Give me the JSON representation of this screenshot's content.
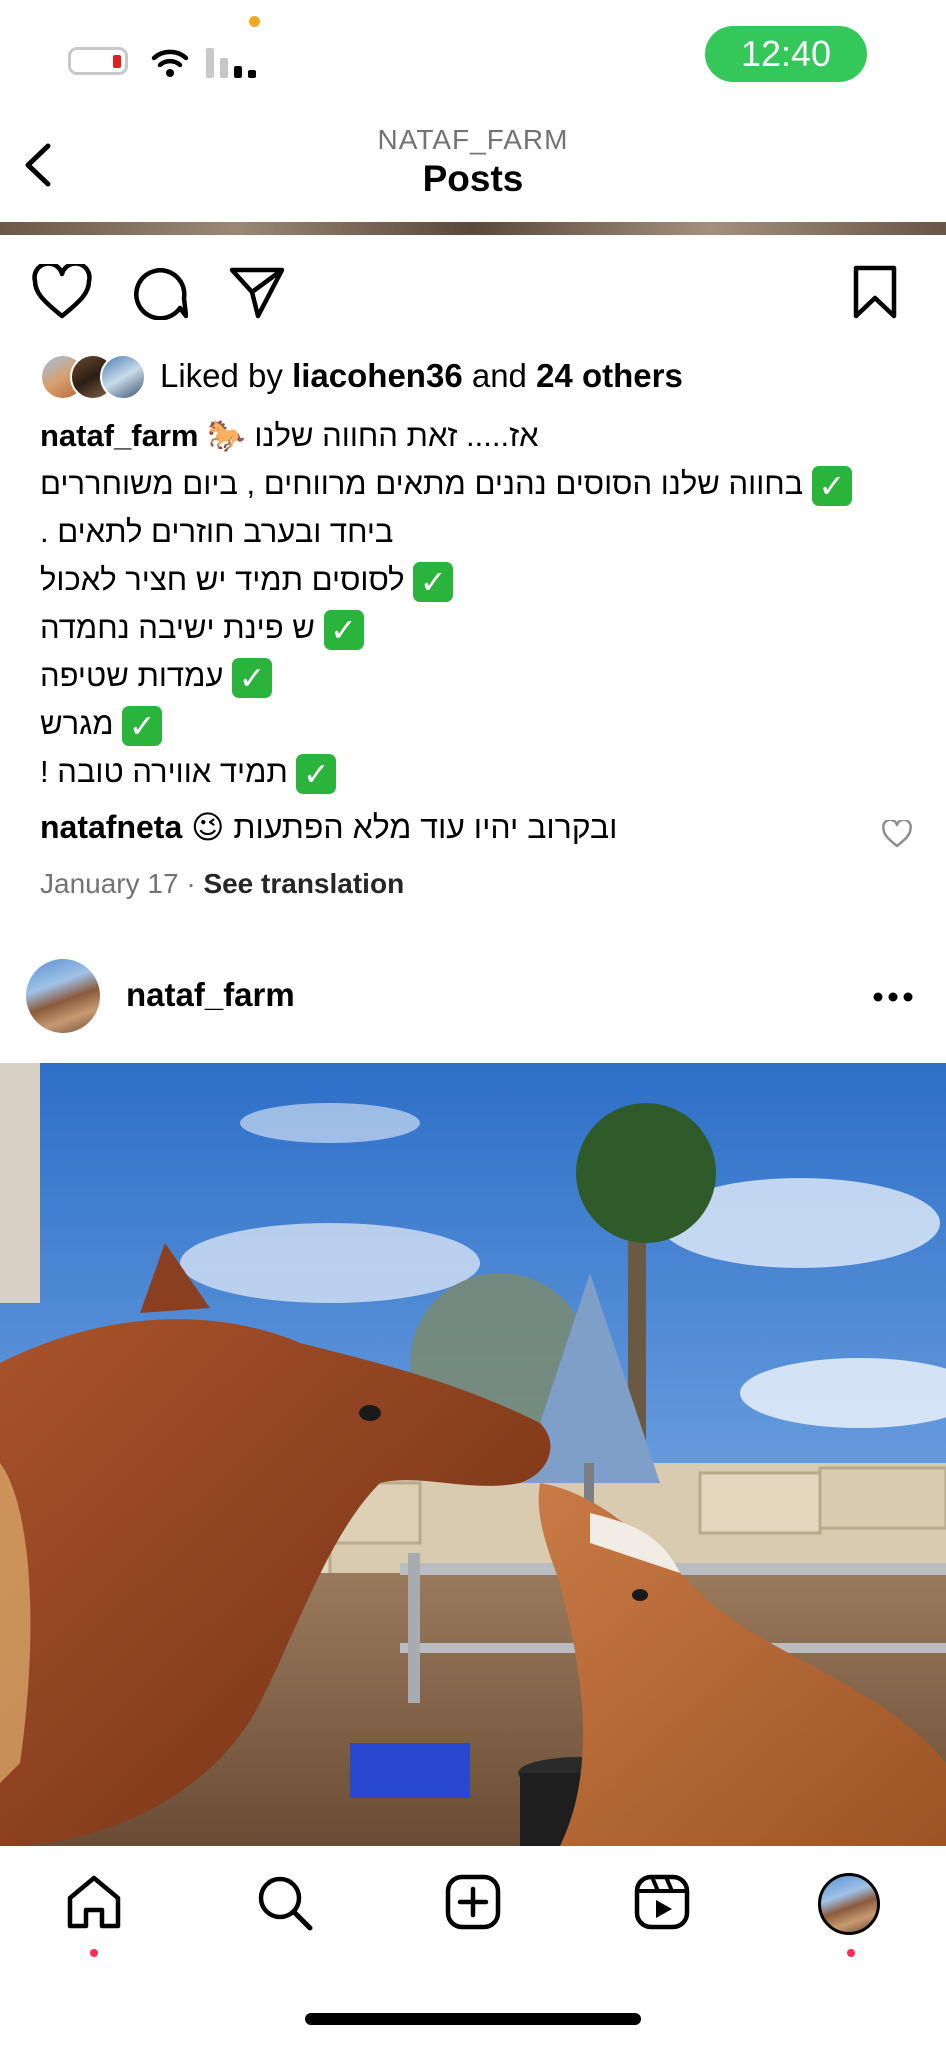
{
  "status_bar": {
    "time": "12:40",
    "battery_level": 0.1
  },
  "nav": {
    "account": "NATAF_FARM",
    "title": "Posts"
  },
  "post1": {
    "liked_by_prefix": "Liked by ",
    "liked_by_user": "liacohen36",
    "liked_by_and": " and ",
    "liked_by_others": "24 others",
    "caption_user": "nataf_farm",
    "caption_lines": [
      "אז..... זאת החווה שלנו 🐎",
      "בחווה שלנו הסוסים נהנים מתאים מרווחים , ביום משוחררים",
      "ביחד ובערב חוזרים לתאים .",
      "לסוסים תמיד יש חציר לאכול",
      "ש פינת ישיבה נחמדה",
      "עמדות שטיפה",
      "מגרש",
      "תמיד אווירה טובה !"
    ],
    "check_mark": "✓",
    "comment_user": "natafneta",
    "comment_text": "ובקרוב יהיו עוד מלא הפתעות 😉",
    "date": "January 17",
    "dot_sep": "·",
    "see_translation": "See translation"
  },
  "post2": {
    "username": "nataf_farm"
  },
  "icons": {
    "back": "chevron-left-icon",
    "like": "heart-icon",
    "comment": "comment-icon",
    "share": "paper-plane-icon",
    "save": "bookmark-icon",
    "more": "more-horizontal-icon",
    "home": "home-icon",
    "search": "search-icon",
    "create": "plus-square-icon",
    "reels": "reels-icon"
  },
  "colors": {
    "accent_green": "#34c759",
    "check_green": "#2ab43b",
    "notification_red": "#ff2a55"
  }
}
